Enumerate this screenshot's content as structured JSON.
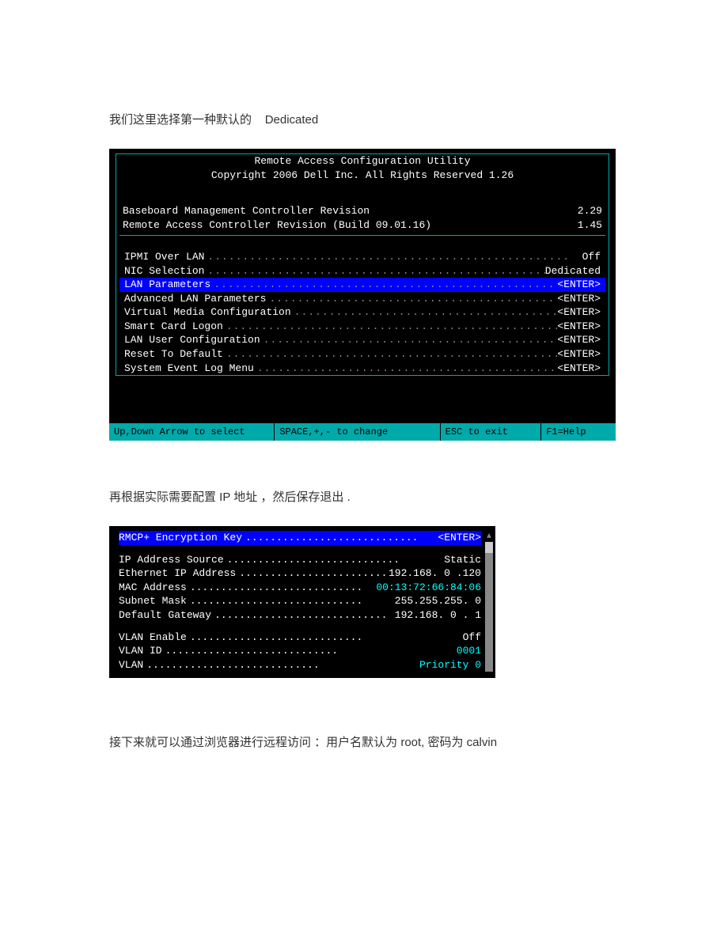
{
  "text1_prefix": "我们这里选择第一种默认的",
  "text1_suffix": "Dedicated",
  "screen1": {
    "title1": "Remote Access Configuration Utility",
    "title2": "Copyright 2006 Dell Inc. All Rights Reserved 1.26",
    "info": [
      {
        "label": "Baseboard Management Controller Revision",
        "value": "2.29"
      },
      {
        "label": "Remote Access Controller Revision (Build 09.01.16)",
        "value": "1.45"
      }
    ],
    "menu": [
      {
        "label": "IPMI Over LAN",
        "value": "Off",
        "selected": false
      },
      {
        "label": "NIC Selection",
        "value": "Dedicated",
        "selected": false
      },
      {
        "label": "LAN Parameters",
        "value": "<ENTER>",
        "selected": true
      },
      {
        "label": "Advanced LAN Parameters",
        "value": "<ENTER>",
        "selected": false
      },
      {
        "label": "Virtual Media Configuration",
        "value": "<ENTER>",
        "selected": false
      },
      {
        "label": "Smart Card Logon",
        "value": "<ENTER>",
        "selected": false
      },
      {
        "label": "LAN User Configuration",
        "value": "<ENTER>",
        "selected": false
      },
      {
        "label": "Reset To Default",
        "value": "<ENTER>",
        "selected": false
      },
      {
        "label": "System Event Log Menu",
        "value": "<ENTER>",
        "selected": false
      }
    ],
    "status": {
      "s1": "Up,Down Arrow to select",
      "s2": "SPACE,+,- to change",
      "s3": "ESC to exit",
      "s4": "F1=Help"
    }
  },
  "text2": "再根据实际需要配置   IP  地址 ，然后保存退出  .",
  "screen2": {
    "rows": [
      {
        "label": "RMCP+ Encryption Key",
        "value": "<ENTER>",
        "selected": true,
        "cyan": false,
        "gap_after": true
      },
      {
        "label": "IP Address Source",
        "value": "Static",
        "selected": false,
        "cyan": false
      },
      {
        "label": "Ethernet IP Address",
        "value": "192.168. 0 .120",
        "selected": false,
        "cyan": false
      },
      {
        "label": "MAC Address",
        "value": "00:13:72:66:84:06",
        "selected": false,
        "cyan": true
      },
      {
        "label": "Subnet Mask",
        "value": "255.255.255. 0",
        "selected": false,
        "cyan": false
      },
      {
        "label": "Default Gateway",
        "value": "192.168. 0 . 1",
        "selected": false,
        "cyan": false,
        "gap_after": true
      },
      {
        "label": "VLAN Enable",
        "value": "Off",
        "selected": false,
        "cyan": false
      },
      {
        "label": "VLAN ID",
        "value": "0001",
        "selected": false,
        "cyan": true
      },
      {
        "label": "VLAN",
        "value": "Priority 0",
        "selected": false,
        "cyan": true
      }
    ]
  },
  "text3": "接下来就可以通过浏览器进行远程访问    ：用户名默认为   root,   密码为 calvin",
  "dots": "...................................................."
}
